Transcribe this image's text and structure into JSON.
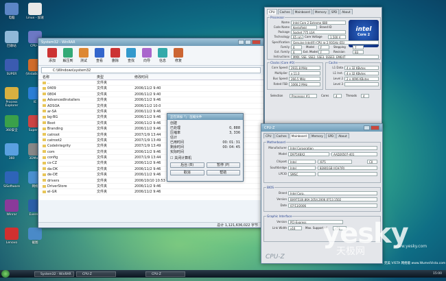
{
  "desktop": {
    "icons": [
      {
        "label": "电脑"
      },
      {
        "label": "Linux - 加速"
      },
      {
        "label": "回收站"
      },
      {
        "label": "CPU-Z"
      },
      {
        "label": "SUPER"
      },
      {
        "label": "(VistaBoost)"
      },
      {
        "label": "Process Explorer"
      },
      {
        "label": "IE"
      },
      {
        "label": "360安全"
      },
      {
        "label": "Super Pi"
      },
      {
        "label": "360"
      },
      {
        "label": "3DMark"
      },
      {
        "label": "SiSoftware"
      },
      {
        "label": "网络"
      },
      {
        "label": "Winrar"
      },
      {
        "label": "Everest"
      },
      {
        "label": "Lenovo"
      },
      {
        "label": "截图"
      }
    ]
  },
  "explorer": {
    "title": "System32 - WinRAR",
    "toolbar": [
      "添加",
      "解压到",
      "测试",
      "查看",
      "删除",
      "查找",
      "向导",
      "信息",
      "修复"
    ],
    "address": "C:\\Windows\\system32",
    "columns": [
      "名称",
      "类型",
      "修改时间"
    ],
    "rows": [
      {
        "name": "..",
        "type": "文件夹",
        "date": ""
      },
      {
        "name": "0409",
        "type": "文件夹",
        "date": "2006/11/2 9:40"
      },
      {
        "name": "0804",
        "type": "文件夹",
        "date": "2006/11/2 9:40"
      },
      {
        "name": "AdvancedInstallers",
        "type": "文件夹",
        "date": "2006/11/2 9:46"
      },
      {
        "name": "ADSOA",
        "type": "文件夹",
        "date": "2006/11/2 10:0"
      },
      {
        "name": "ar-SA",
        "type": "文件夹",
        "date": "2006/11/2 9:46"
      },
      {
        "name": "bg-BG",
        "type": "文件夹",
        "date": "2006/11/2 9:46"
      },
      {
        "name": "Boot",
        "type": "文件夹",
        "date": "2006/11/2 9:46"
      },
      {
        "name": "Branding",
        "type": "文件夹",
        "date": "2006/11/2 9:46"
      },
      {
        "name": "catroot",
        "type": "文件夹",
        "date": "2007/1/9 13:44"
      },
      {
        "name": "catroot2",
        "type": "文件夹",
        "date": "2007/1/9 13:49"
      },
      {
        "name": "CodeIntegrity",
        "type": "文件夹",
        "date": "2007/1/9 13:49"
      },
      {
        "name": "com",
        "type": "文件夹",
        "date": "2006/11/2 9:46"
      },
      {
        "name": "config",
        "type": "文件夹",
        "date": "2007/1/9 13:44"
      },
      {
        "name": "cs-CZ",
        "type": "文件夹",
        "date": "2006/11/2 9:46"
      },
      {
        "name": "da-DK",
        "type": "文件夹",
        "date": "2006/11/2 9:46"
      },
      {
        "name": "de-DE",
        "type": "文件夹",
        "date": "2006/11/2 9:46"
      },
      {
        "name": "drivers",
        "type": "文件夹",
        "date": "2006/10/10 10:53"
      },
      {
        "name": "DriverStore",
        "type": "文件夹",
        "date": "2006/11/2 9:46"
      },
      {
        "name": "el-GR",
        "type": "文件夹",
        "date": "2006/11/2 9:46"
      }
    ],
    "status": "总计 1,121,636,022 字节"
  },
  "dialog": {
    "title": "正在添加「」 压缩文件",
    "header": "创建",
    "lines": [
      {
        "k": "已处理",
        "v": "0, 888"
      },
      {
        "k": "压缩率",
        "v": "3, 336"
      },
      {
        "k": "估计",
        "v": ""
      },
      {
        "k": "已用时间",
        "v": "00: 01: 31"
      },
      {
        "k": "剩余时间",
        "v": "00: 04: 45"
      },
      {
        "k": "实际时间",
        "v": ""
      }
    ],
    "checkbox": "关闭计算机",
    "buttons": [
      "后台 (B)",
      "暂停 (P)",
      "取消",
      "帮助"
    ]
  },
  "cpuz_main": {
    "tabs": [
      "CPU",
      "Caches",
      "Mainboard",
      "Memory",
      "SPD",
      "About"
    ],
    "processor": {
      "title": "Processor",
      "name": "Intel Core 2 Extreme 680",
      "code_name": "Kentsfield",
      "brand_id": "Brand ID",
      "package": "Socket 775 LGA",
      "technology": "65 nm",
      "core_voltage": "1.500 V"
    },
    "spec": "Genuine Intel(R) CPU          @ 2.93GHz (ES)",
    "family": "6",
    "model": "F",
    "stepping": "7",
    "ext_family": "6",
    "ext_model": "F",
    "revision": "B3",
    "instructions": "MMX, SSE, SSE2, SSE3, SSSE3, EM64T",
    "clocks": {
      "title": "Clocks (Core #0)",
      "core_speed": "2931.8 MHz",
      "multiplier": "x 11.0",
      "bus_speed": "266.5 MHz",
      "rated_fsb": "1066.2 MHz"
    },
    "cache": {
      "title": "Cache",
      "l1_data": "4 x 32 KBytes",
      "l1_inst": "4 x 32 KBytes",
      "level2": "2 x 4096 KBytes",
      "level3": ""
    },
    "selection": "Processor #1",
    "cores": "4",
    "threads": "4",
    "labels": {
      "name": "Name",
      "code_name": "Code Name",
      "package": "Package",
      "technology": "Technology",
      "core_voltage": "Core Voltage",
      "specification": "Specification",
      "family": "Family",
      "model": "Model",
      "stepping": "Stepping",
      "ext_family": "Ext. Family",
      "ext_model": "Ext. Model",
      "revision": "Revision",
      "instructions": "Instructions",
      "core_speed": "Core Speed",
      "multiplier": "Multiplier",
      "bus_speed": "Bus Speed",
      "rated_fsb": "Rated FSB",
      "l1_data": "L1 Data",
      "l1_inst": "L1 Inst.",
      "level2": "Level 2",
      "level3": "Level 3",
      "selection": "Selection",
      "cores": "Cores",
      "threads": "Threads"
    },
    "logo_text": "intel",
    "logo_sub": "Core 2"
  },
  "cpuz_mb": {
    "title": "CPU-Z",
    "tabs": [
      "CPU",
      "Caches",
      "Mainboard",
      "Memory",
      "SPD",
      "About"
    ],
    "mb_title": "Motherboard",
    "manufacturer": "Intel Corporation",
    "model": "D975XBX2",
    "model_rev": "AAD26507-401",
    "chipset_brand": "Intel",
    "chipset": "i975",
    "chipset_rev": "C0",
    "southbridge_brand": "Intel",
    "southbridge": "82801GB (ICH7/R)",
    "lpcio_brand": "SMSC",
    "lpcio": "",
    "bios_title": "BIOS",
    "bios_brand": "Intel Corp.",
    "bios_version": "BX97510J.86A.1054.2006.0713.1502",
    "bios_date": "07/13/2006",
    "graphic_title": "Graphic Interface",
    "gi_version": "PCI-Express",
    "gi_link_width": "x16",
    "gi_max": "x16",
    "labels": {
      "manufacturer": "Manufacturer",
      "model": "Model",
      "chipset": "Chipset",
      "southbridge": "Southbridge",
      "lpcio": "LPCIO",
      "brand": "Brand",
      "version": "Version",
      "date": "Date",
      "link_width": "Link Width",
      "max_supported": "Max. Supported"
    },
    "footer": "CPU-Z"
  },
  "taskbar": {
    "tasks": [
      "System32 - WinRAR",
      "CPU-Z",
      "CPU-Z"
    ],
    "clock": "15:00"
  },
  "watermark": {
    "text": "yesky",
    "sub": "天极网",
    "site": "www.yesky.com",
    "caption": "完美 VISTA 网络版 www.WumeiVista.com"
  }
}
